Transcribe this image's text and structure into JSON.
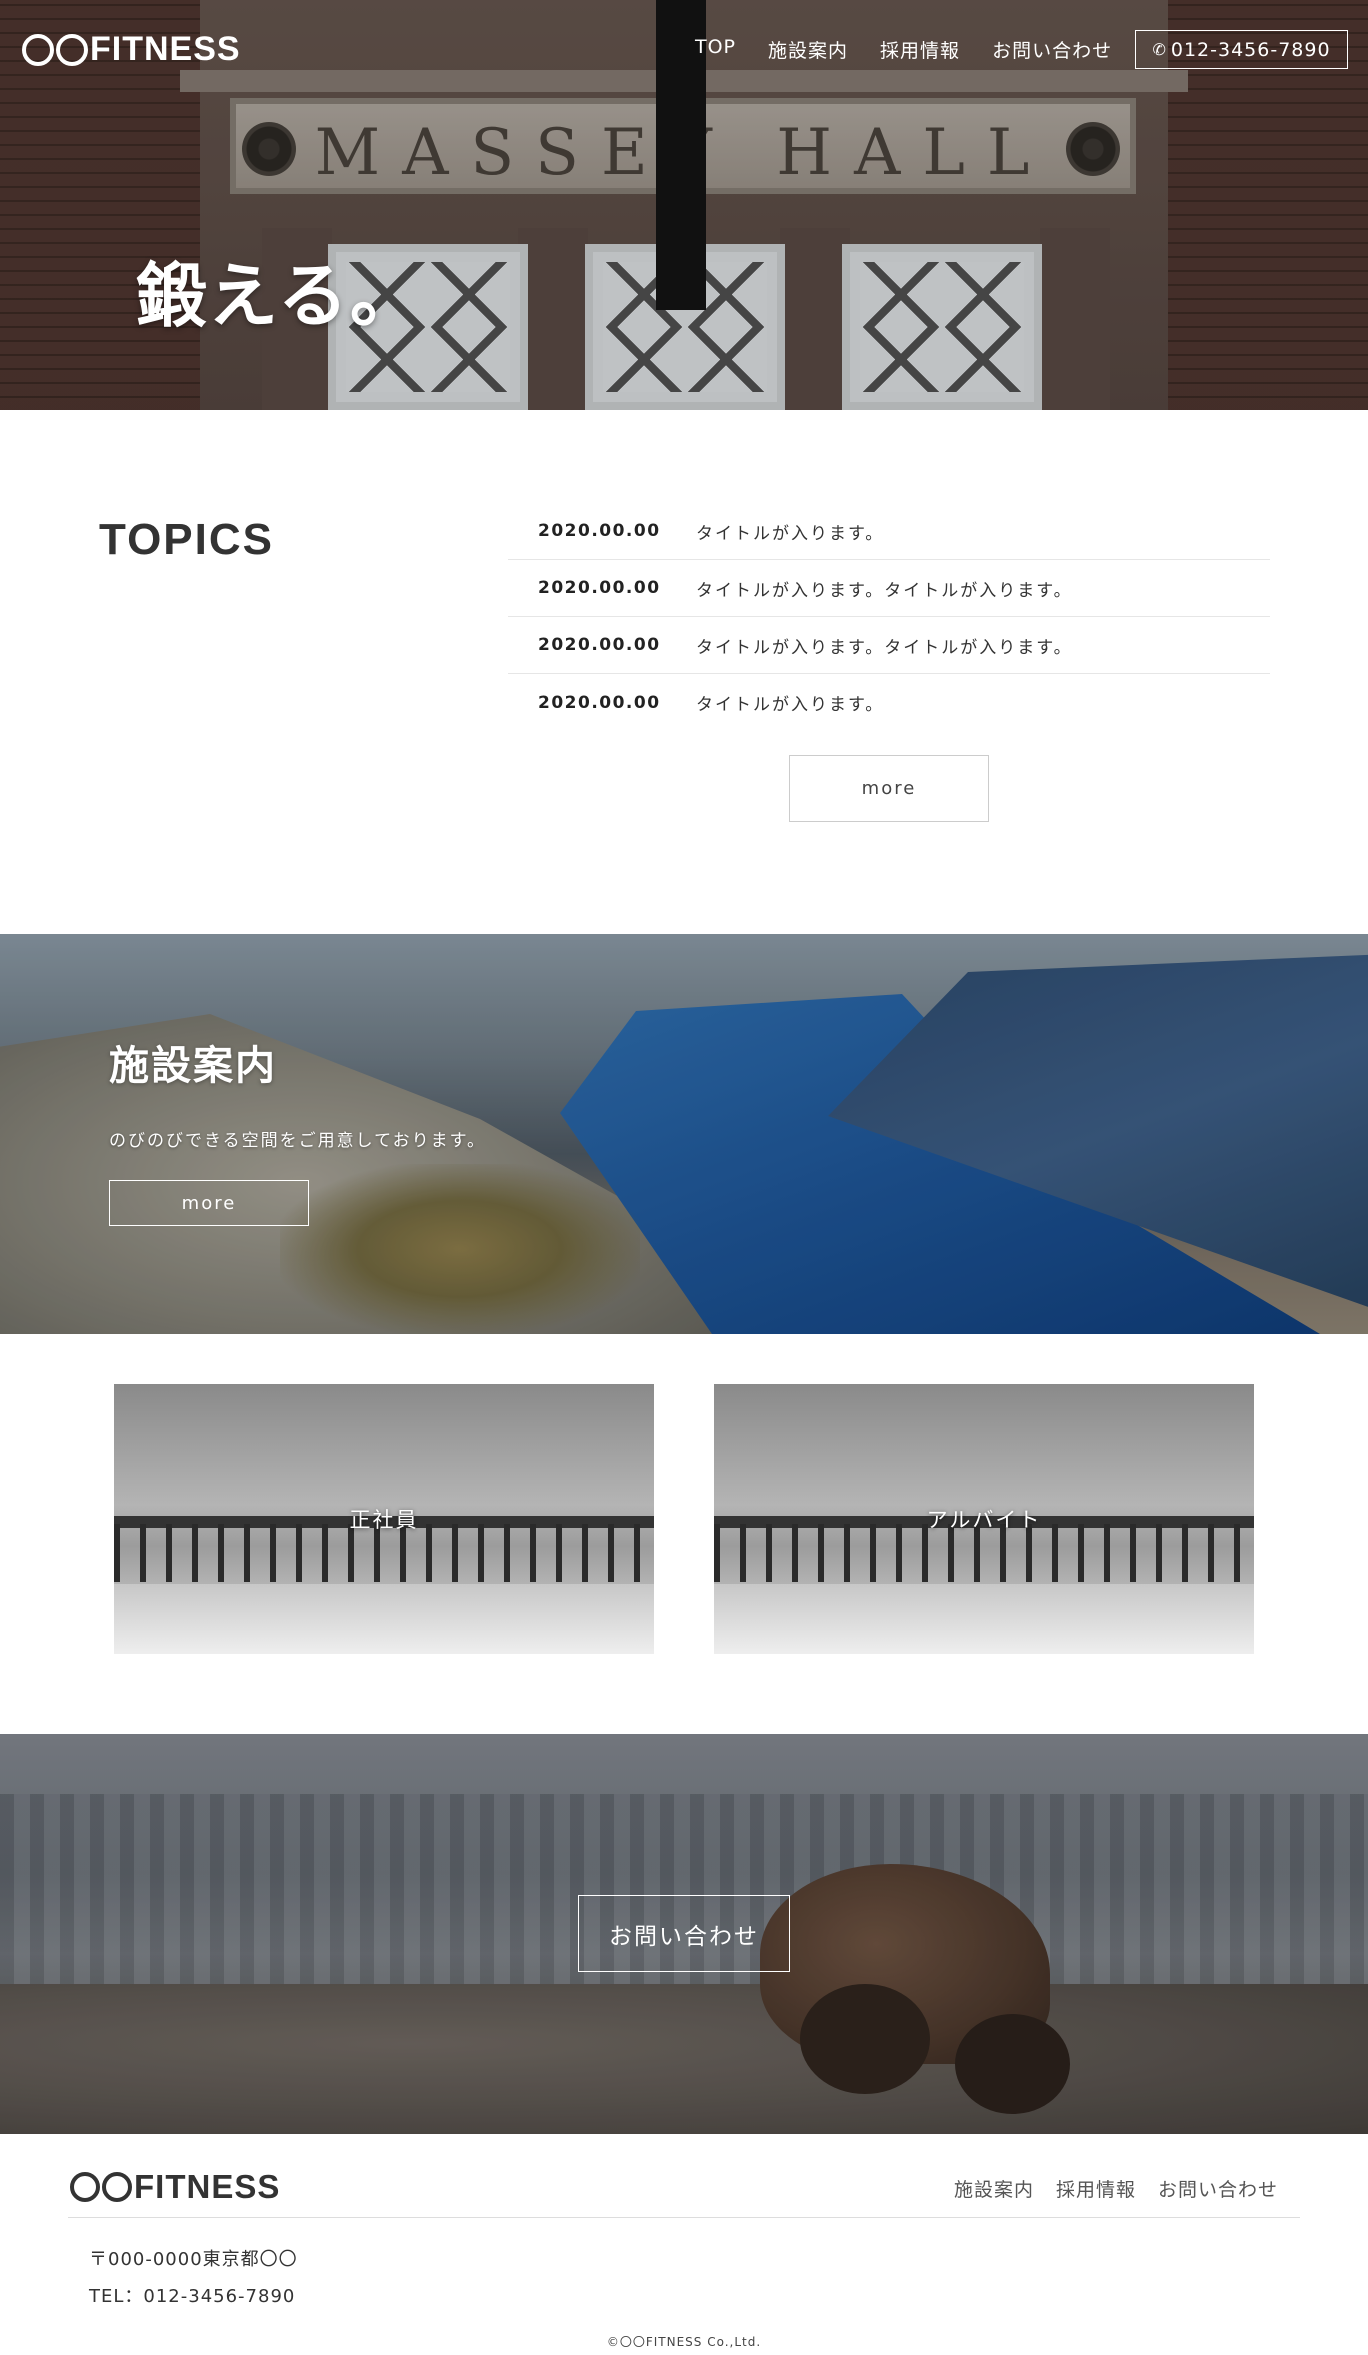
{
  "header": {
    "logo_text": "FITNESS",
    "nav": [
      "TOP",
      "施設案内",
      "採用情報",
      "お問い合わせ"
    ],
    "tel": "012-3456-7890",
    "phone_icon": "phone-icon"
  },
  "hero": {
    "sign_text": "MASSEY HALL",
    "title": "鍛える。"
  },
  "topics": {
    "heading": "TOPICS",
    "items": [
      {
        "date": "2020.00.00",
        "title": "タイトルが入ります。"
      },
      {
        "date": "2020.00.00",
        "title": "タイトルが入ります。タイトルが入ります。"
      },
      {
        "date": "2020.00.00",
        "title": "タイトルが入ります。タイトルが入ります。"
      },
      {
        "date": "2020.00.00",
        "title": "タイトルが入ります。"
      }
    ],
    "more_label": "more"
  },
  "facility": {
    "title": "施設案内",
    "text": "のびのびできる空間をご用意しております。",
    "more_label": "more"
  },
  "recruit": {
    "cards": [
      {
        "label": "正社員"
      },
      {
        "label": "アルバイト"
      }
    ]
  },
  "contact": {
    "button_label": "お問い合わせ"
  },
  "footer": {
    "logo_text": "FITNESS",
    "nav": [
      "施設案内",
      "採用情報",
      "お問い合わせ"
    ],
    "address": "〒000-0000東京都〇〇",
    "tel": "TEL：012-3456-7890",
    "copyright": "©〇〇FITNESS Co.,Ltd."
  },
  "colors": {
    "text": "#333333",
    "white": "#ffffff",
    "divider": "#dddddd"
  }
}
